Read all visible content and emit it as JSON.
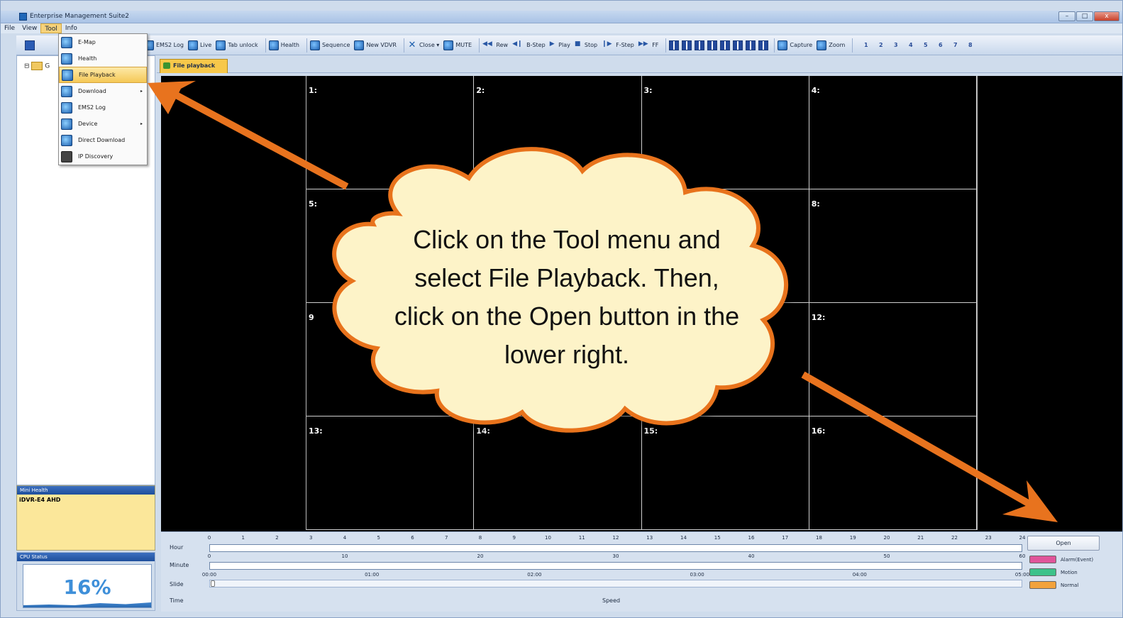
{
  "window": {
    "title": "Enterprise Management Suite2",
    "min": "–",
    "max": "□",
    "close": "x"
  },
  "menu": [
    "File",
    "View",
    "Tool",
    "Info"
  ],
  "toolbar": {
    "ems2log": "EMS2 Log",
    "live": "Live",
    "tabunlock": "Tab unlock",
    "health": "Health",
    "sequence": "Sequence",
    "newvdvr": "New VDVR",
    "close": "Close ▾",
    "mute": "MUTE",
    "rew": "Rew",
    "bstep": "B-Step",
    "play": "Play",
    "stop": "Stop",
    "fstep": "F-Step",
    "ff": "FF",
    "capture": "Capture",
    "zoom": "Zoom",
    "channels": [
      "1",
      "2",
      "3",
      "4",
      "5",
      "6",
      "7",
      "8"
    ]
  },
  "tool_menu": {
    "items": [
      {
        "label": "E-Map",
        "arrow": ""
      },
      {
        "label": "Health",
        "arrow": ""
      },
      {
        "label": "File Playback",
        "arrow": ""
      },
      {
        "label": "Download",
        "arrow": "▸"
      },
      {
        "label": "EMS2 Log",
        "arrow": ""
      },
      {
        "label": "Device",
        "arrow": "▸"
      },
      {
        "label": "Direct Download",
        "arrow": ""
      },
      {
        "label": "IP Discovery",
        "arrow": ""
      }
    ]
  },
  "tree": {
    "root": "G"
  },
  "tab": {
    "label": "File playback"
  },
  "cells": [
    "1:",
    "2:",
    "3:",
    "4:",
    "5:",
    "",
    "",
    "8:",
    "9",
    "",
    "",
    "12:",
    "13:",
    "14:",
    "15:",
    "16:"
  ],
  "mini_health": {
    "header": "Mini Health",
    "device": "iDVR-E4 AHD"
  },
  "cpu": {
    "header": "CPU Status",
    "value": "16%"
  },
  "timeline": {
    "labels": {
      "hour": "Hour",
      "minute": "Minute",
      "slide": "Slide",
      "time": "Time",
      "speed": "Speed"
    },
    "hour_ticks": [
      "0",
      "1",
      "2",
      "3",
      "4",
      "5",
      "6",
      "7",
      "8",
      "9",
      "10",
      "11",
      "12",
      "13",
      "14",
      "15",
      "16",
      "17",
      "18",
      "19",
      "20",
      "21",
      "22",
      "23",
      "24"
    ],
    "minute_ticks": [
      "0",
      "10",
      "20",
      "30",
      "40",
      "50",
      "60"
    ],
    "slide_ticks": [
      "00:00",
      "01:00",
      "02:00",
      "03:00",
      "04:00",
      "05:00"
    ]
  },
  "open_button": "Open",
  "legend": [
    {
      "label": "Alarm(Event)",
      "color": "#e0559a"
    },
    {
      "label": "Motion",
      "color": "#3cc28a"
    },
    {
      "label": "Normal",
      "color": "#f2a23c"
    }
  ],
  "annotation": {
    "lines": [
      "Click on the Tool menu and",
      "select File Playback. Then,",
      "click on the Open button in the",
      "lower right."
    ],
    "arrow_color": "#e8731e",
    "cloud_color": "#fdf3c8"
  }
}
